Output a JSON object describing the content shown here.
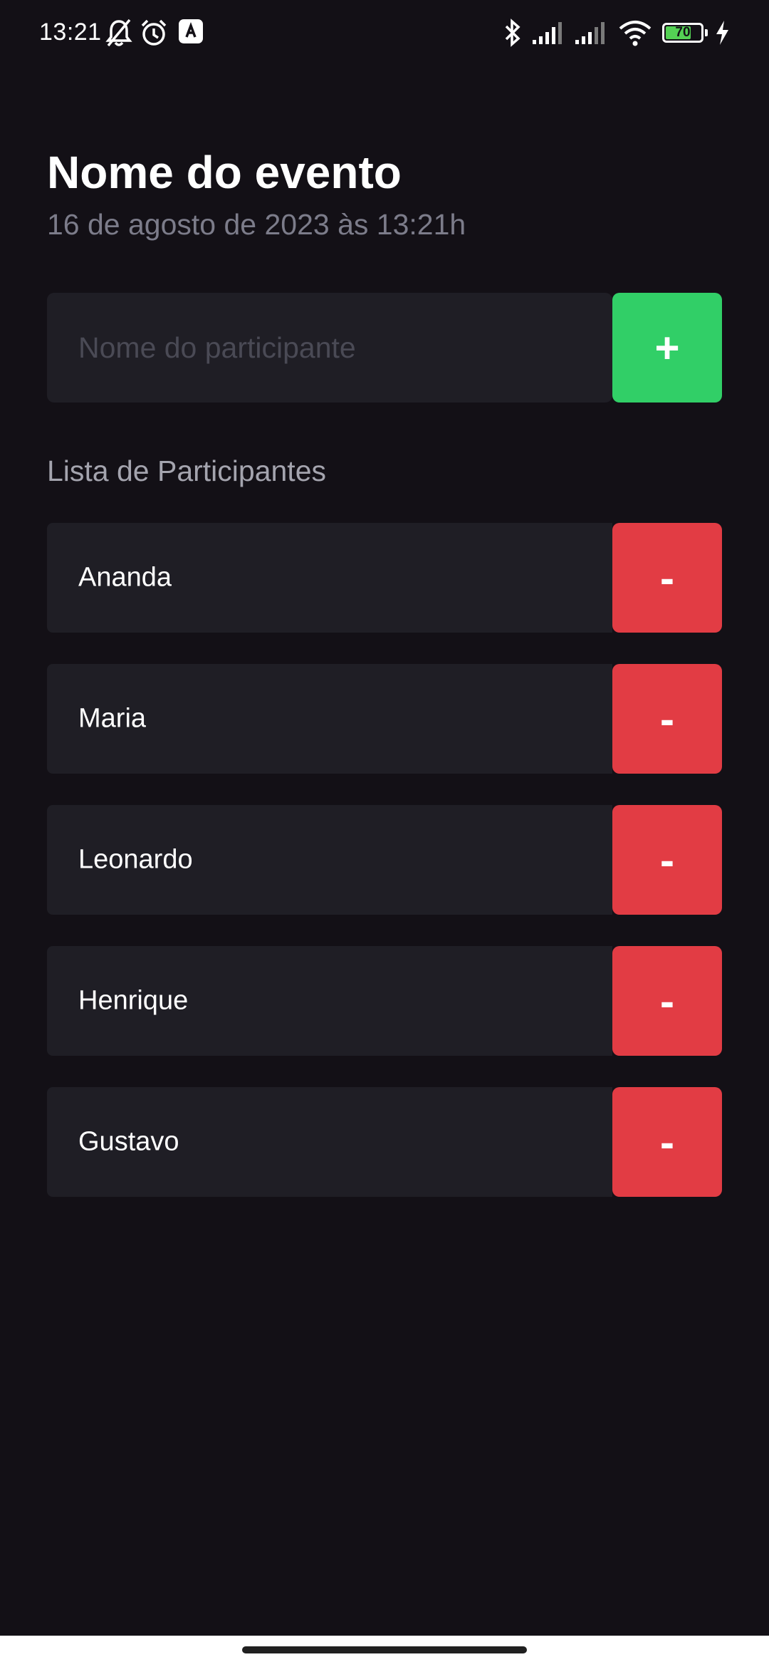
{
  "status_bar": {
    "time": "13:21",
    "battery_level": "70",
    "icons": [
      "bell-off-icon",
      "alarm-icon",
      "app-notification-icon",
      "bluetooth-icon",
      "signal-icon",
      "signal-icon",
      "wifi-icon",
      "battery-icon",
      "charging-icon"
    ]
  },
  "header": {
    "title": "Nome do evento",
    "date": "16 de agosto de 2023 às 13:21h"
  },
  "form": {
    "input_placeholder": "Nome do participante",
    "input_value": "",
    "add_label": "+"
  },
  "list": {
    "title": "Lista de Participantes",
    "remove_label": "-",
    "participants": [
      {
        "name": "Ananda"
      },
      {
        "name": "Maria"
      },
      {
        "name": "Leonardo"
      },
      {
        "name": "Henrique"
      },
      {
        "name": "Gustavo"
      }
    ]
  },
  "colors": {
    "background": "#131016",
    "card": "#1f1e25",
    "add_button": "#31cf67",
    "remove_button": "#e23c44",
    "muted_text": "#7c7c8a"
  }
}
